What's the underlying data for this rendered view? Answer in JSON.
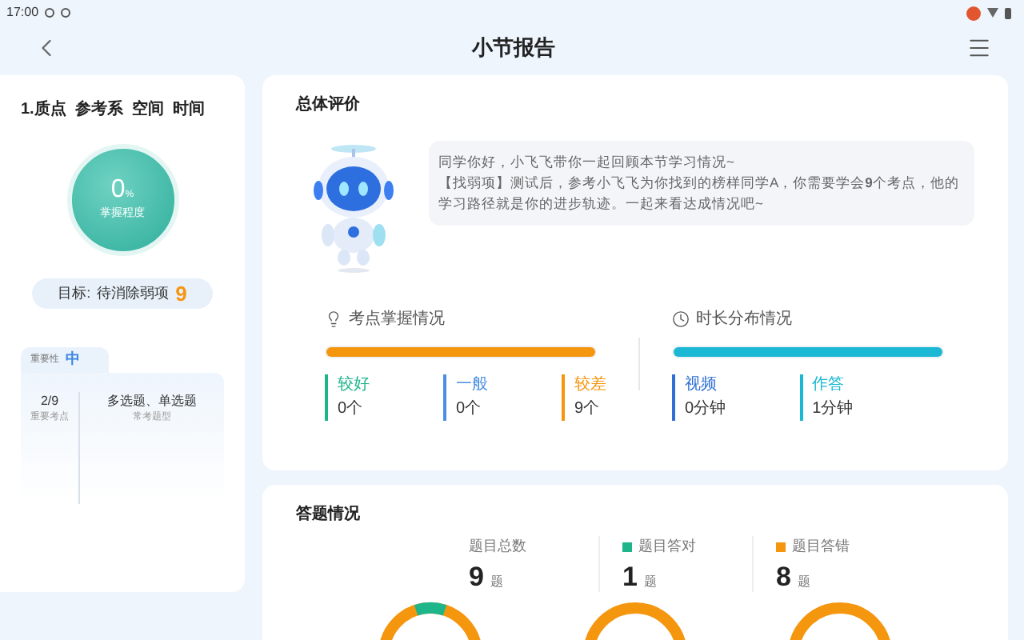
{
  "status_bar": {
    "time": "17:00"
  },
  "header": {
    "title": "小节报告"
  },
  "section_card": {
    "title": "1.质点  参考系  空间  时间",
    "mastery_value": "0",
    "mastery_unit": "%",
    "mastery_label": "掌握程度",
    "goal_label": "目标:",
    "goal_text": "待消除弱项",
    "goal_count": "9",
    "importance_label": "重要性",
    "importance_value": "中",
    "stats": [
      {
        "value": "2/9",
        "label": "重要考点"
      },
      {
        "value": "多选题、单选题",
        "label": "常考题型"
      }
    ]
  },
  "overall": {
    "title": "总体评价",
    "messages": [
      "同学你好，小飞飞带你一起回顾本节学习情况~",
      "【找弱项】测试后，参考小飞飞为你找到的榜样同学A，你需要学会**9**个考点，他的学习路径就是你的进步轨迹。一起来看达成情况吧~"
    ],
    "mastery": {
      "title": "考点掌握情况",
      "level": 1,
      "items": [
        {
          "label": "较好",
          "value": "0个",
          "color": "#1fb58a"
        },
        {
          "label": "一般",
          "value": "0个",
          "color": "#4a8fe0"
        },
        {
          "label": "较差",
          "value": "9个",
          "color": "#f5960f"
        }
      ]
    },
    "time": {
      "title": "时长分布情况",
      "level": 1,
      "items": [
        {
          "label": "视频",
          "value": "0分钟",
          "color": "#2f6fd6"
        },
        {
          "label": "作答",
          "value": "1分钟",
          "color": "#1ab8d4"
        }
      ]
    }
  },
  "answers": {
    "title": "答题情况",
    "stats": [
      {
        "label": "题目总数",
        "value": "9",
        "unit": "题"
      },
      {
        "label": "题目答对",
        "value": "1",
        "unit": "题",
        "color": "#1fb58a"
      },
      {
        "label": "题目答错",
        "value": "8",
        "unit": "题",
        "color": "#f5960f"
      }
    ]
  }
}
